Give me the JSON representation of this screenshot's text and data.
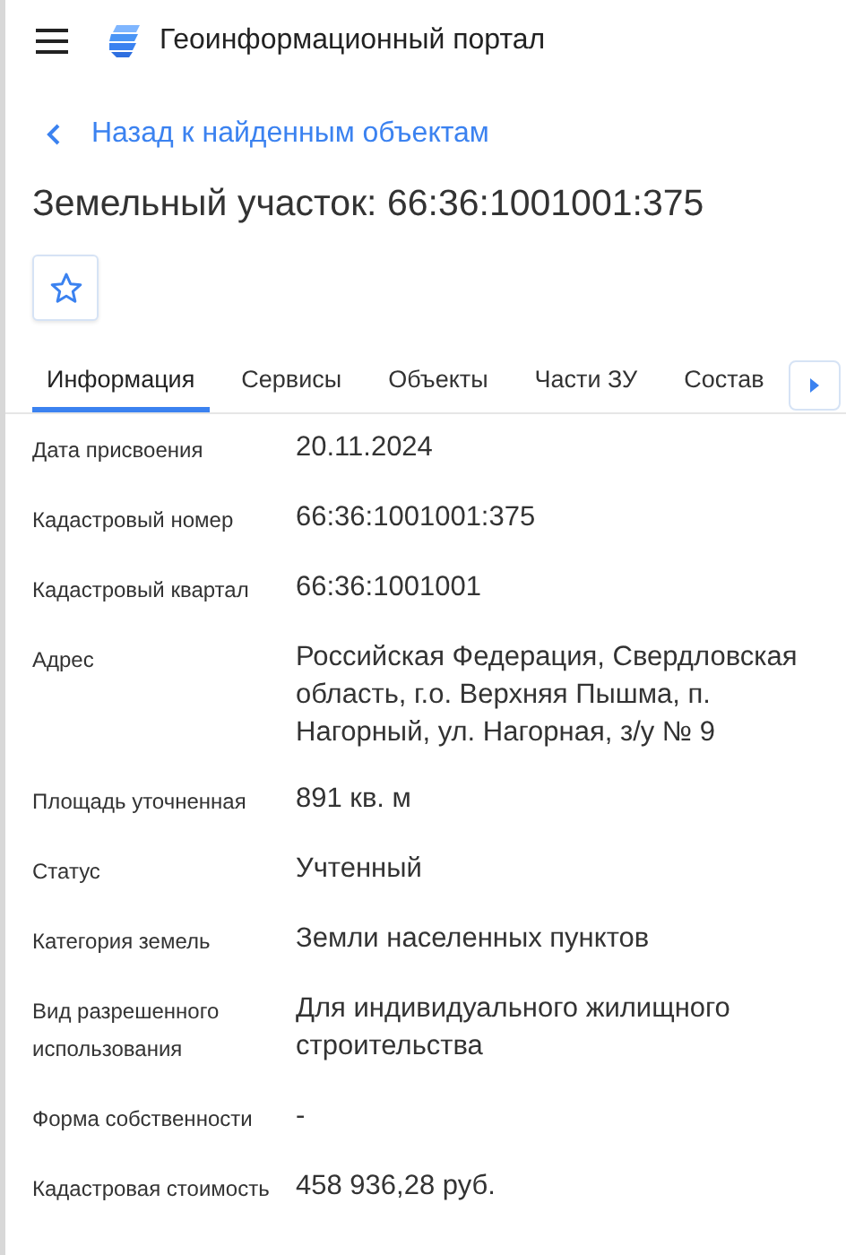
{
  "header": {
    "title": "Геоинформационный портал"
  },
  "back_link": "Назад к найденным объектам",
  "title": "Земельный участок: 66:36:1001001:375",
  "favorite": {
    "selected": false
  },
  "tabs": [
    {
      "label": "Информация",
      "selected": true
    },
    {
      "label": "Сервисы",
      "selected": false
    },
    {
      "label": "Объекты",
      "selected": false
    },
    {
      "label": "Части ЗУ",
      "selected": false
    },
    {
      "label": "Состав",
      "selected": false
    }
  ],
  "fields": [
    {
      "label": "Дата присвоения",
      "value": "20.11.2024"
    },
    {
      "label": "Кадастровый номер",
      "value": "66:36:1001001:375"
    },
    {
      "label": "Кадастровый квартал",
      "value": "66:36:1001001"
    },
    {
      "label": "Адрес",
      "value": "Российская Федерация, Свердловская область, г.о. Верхняя Пышма, п. Нагорный, ул. Нагорная, з/у № 9"
    },
    {
      "label": "Площадь уточненная",
      "value": "891 кв. м"
    },
    {
      "label": "Статус",
      "value": "Учтенный"
    },
    {
      "label": "Категория земель",
      "value": "Земли населенных пунктов"
    },
    {
      "label": "Вид разрешенного использования",
      "value": "Для индивидуального жилищного строительства"
    },
    {
      "label": "Форма собственности",
      "value": "-"
    },
    {
      "label": "Кадастровая стоимость",
      "value": "458 936,28 руб."
    }
  ]
}
